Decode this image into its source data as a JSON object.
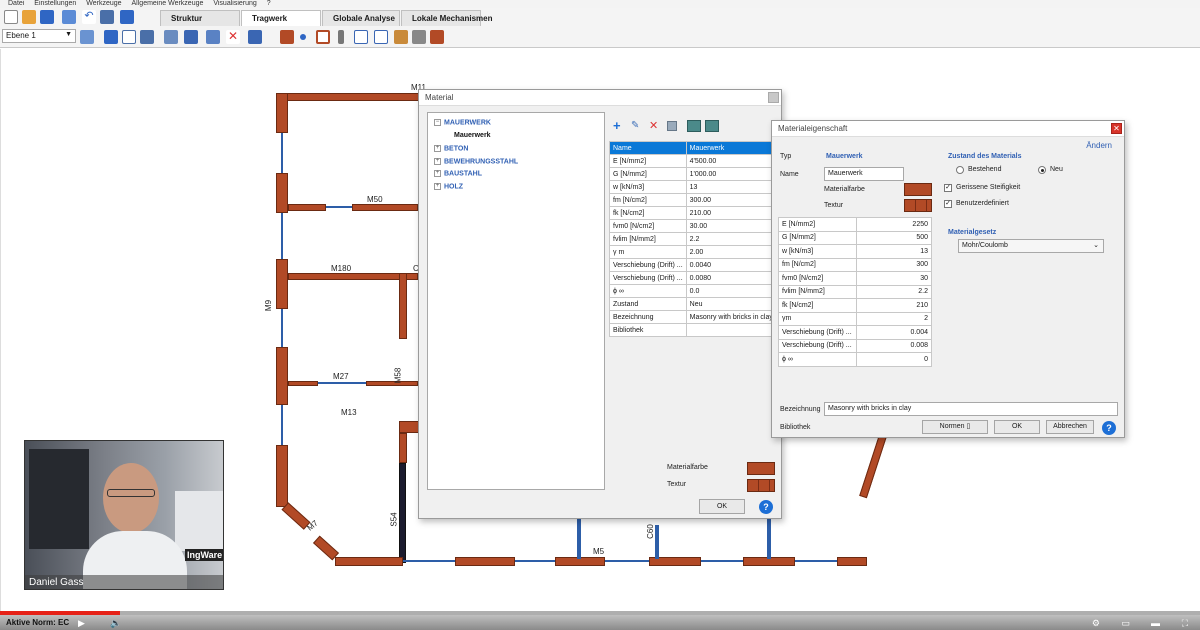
{
  "menu": [
    "Datei",
    "Einstellungen",
    "Werkzeuge",
    "Allgemeine Werkzeuge",
    "Visualisierung",
    "?"
  ],
  "tabs": [
    "Struktur",
    "Tragwerk",
    "Globale Analyse",
    "Lokale Mechanismen"
  ],
  "active_tab": "Tragwerk",
  "level": "Ebene 1",
  "wall_labels": [
    "M11",
    "M50",
    "M180",
    "M27",
    "M9",
    "M13",
    "M7",
    "S54",
    "M5",
    "C60",
    "M58",
    "C"
  ],
  "material_dialog": {
    "title": "Material",
    "tree": [
      "MAUERWERK",
      "BETON",
      "BEWEHRUNGSSTAHL",
      "BAUSTAHL",
      "HOLZ"
    ],
    "tree_selected": "Mauerwerk",
    "props": [
      [
        "Name",
        "Mauerwerk"
      ],
      [
        "E [N/mm2]",
        "4'500.00"
      ],
      [
        "G [N/mm2]",
        "1'000.00"
      ],
      [
        "w [kN/m3]",
        "13"
      ],
      [
        "fm [N/cm2]",
        "300.00"
      ],
      [
        "fk [N/cm2]",
        "210.00"
      ],
      [
        "fvm0 [N/cm2]",
        "30.00"
      ],
      [
        "fvlim [N/mm2]",
        "2.2"
      ],
      [
        "γ m",
        "2.00"
      ],
      [
        "Verschiebung (Drift) ...",
        "0.0040"
      ],
      [
        "Verschiebung (Drift) ...",
        "0.0080"
      ],
      [
        "ϕ ∞",
        "0.0"
      ],
      [
        "Zustand",
        "Neu"
      ],
      [
        "Bezeichnung",
        "Masonry with bricks in clay"
      ],
      [
        "Bibliothek",
        ""
      ]
    ],
    "materialfarbe": "Materialfarbe",
    "textur": "Textur",
    "ok": "OK",
    "help": "?"
  },
  "eig_dialog": {
    "title": "Materialeigenschaft",
    "aendern": "Ändern",
    "typ_label": "Typ",
    "typ_value": "Mauerwerk",
    "name_label": "Name",
    "name_value": "Mauerwerk",
    "materialfarbe": "Materialfarbe",
    "textur": "Textur",
    "zustand_title": "Zustand des Materials",
    "bestehend": "Bestehend",
    "neu": "Neu",
    "gerissene": "Gerissene Steifigkeit",
    "benutzer": "Benutzerdefiniert",
    "gesetz_title": "Materialgesetz",
    "gesetz_value": "Mohr/Coulomb",
    "values": [
      [
        "E [N/mm2]",
        "2250"
      ],
      [
        "G [N/mm2]",
        "500"
      ],
      [
        "w [kN/m3]",
        "13"
      ],
      [
        "fm [N/cm2]",
        "300"
      ],
      [
        "fvm0 [N/cm2]",
        "30"
      ],
      [
        "fvlim [N/mm2]",
        "2.2"
      ],
      [
        "fk [N/cm2]",
        "210"
      ],
      [
        "γm",
        "2"
      ],
      [
        "Verschiebung (Drift) ...",
        "0.004"
      ],
      [
        "Verschiebung (Drift) ...",
        "0.008"
      ],
      [
        "ϕ ∞",
        "0"
      ]
    ],
    "bezeichnung_label": "Bezeichnung",
    "bezeichnung_value": "Masonry with bricks in clay",
    "bibliothek_label": "Bibliothek",
    "normen": "Normen",
    "ok": "OK",
    "abbrechen": "Abbrechen",
    "help": "?"
  },
  "webcam": {
    "name": "Daniel Gass",
    "logo": "IngWare"
  },
  "status": {
    "text": "Aktive Norm: EC",
    "progress": 0.1
  },
  "colors": {
    "wall": "#b24a26",
    "accent": "#0a78d7"
  }
}
